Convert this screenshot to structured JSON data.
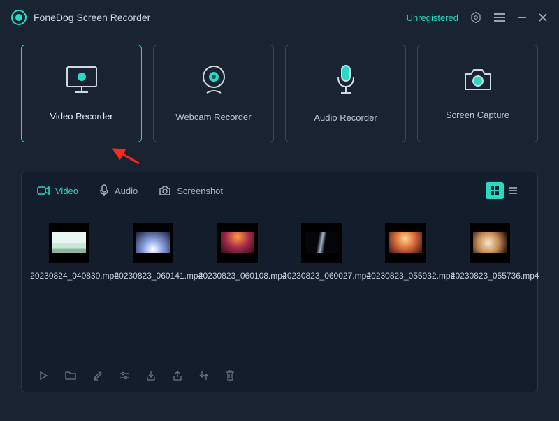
{
  "header": {
    "title": "FoneDog Screen Recorder",
    "unregistered": "Unregistered"
  },
  "modes": [
    {
      "label": "Video Recorder"
    },
    {
      "label": "Webcam Recorder"
    },
    {
      "label": "Audio Recorder"
    },
    {
      "label": "Screen Capture"
    }
  ],
  "tabs": {
    "video": "Video",
    "audio": "Audio",
    "screenshot": "Screenshot"
  },
  "files": [
    {
      "name": "20230824_040830.mp4"
    },
    {
      "name": "20230823_060141.mp4"
    },
    {
      "name": "20230823_060108.mp4"
    },
    {
      "name": "20230823_060027.mp4"
    },
    {
      "name": "20230823_055932.mp4"
    },
    {
      "name": "20230823_055736.mp4"
    }
  ]
}
